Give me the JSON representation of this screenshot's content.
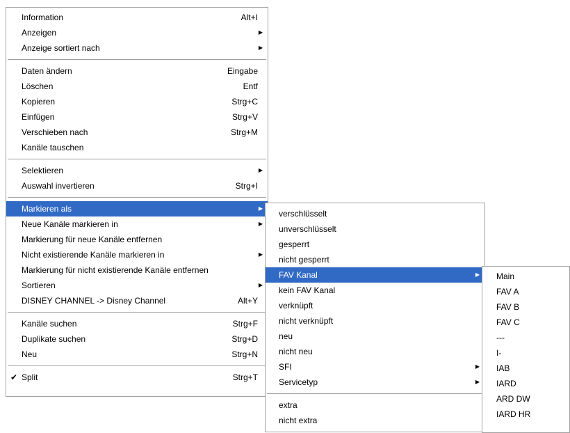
{
  "main_menu": {
    "groups": [
      [
        {
          "label": "Information",
          "shortcut": "Alt+I",
          "submenu": false
        },
        {
          "label": "Anzeigen",
          "shortcut": "",
          "submenu": true
        },
        {
          "label": "Anzeige sortiert nach",
          "shortcut": "",
          "submenu": true
        }
      ],
      [
        {
          "label": "Daten ändern",
          "shortcut": "Eingabe",
          "submenu": false
        },
        {
          "label": "Löschen",
          "shortcut": "Entf",
          "submenu": false
        },
        {
          "label": "Kopieren",
          "shortcut": "Strg+C",
          "submenu": false
        },
        {
          "label": "Einfügen",
          "shortcut": "Strg+V",
          "submenu": false
        },
        {
          "label": "Verschieben nach",
          "shortcut": "Strg+M",
          "submenu": false
        },
        {
          "label": "Kanäle tauschen",
          "shortcut": "",
          "submenu": false
        }
      ],
      [
        {
          "label": "Selektieren",
          "shortcut": "",
          "submenu": true
        },
        {
          "label": "Auswahl invertieren",
          "shortcut": "Strg+I",
          "submenu": false
        }
      ],
      [
        {
          "label": "Markieren als",
          "shortcut": "",
          "submenu": true,
          "highlighted": true
        },
        {
          "label": "Neue Kanäle markieren in",
          "shortcut": "",
          "submenu": true
        },
        {
          "label": "Markierung für neue Kanäle entfernen",
          "shortcut": "",
          "submenu": false
        },
        {
          "label": "Nicht existierende Kanäle markieren in",
          "shortcut": "",
          "submenu": true
        },
        {
          "label": "Markierung für nicht existierende Kanäle entfernen",
          "shortcut": "",
          "submenu": false
        },
        {
          "label": "Sortieren",
          "shortcut": "",
          "submenu": true
        },
        {
          "label": "DISNEY CHANNEL -> Disney Channel",
          "shortcut": "Alt+Y",
          "submenu": false
        }
      ],
      [
        {
          "label": "Kanäle suchen",
          "shortcut": "Strg+F",
          "submenu": false
        },
        {
          "label": "Duplikate suchen",
          "shortcut": "Strg+D",
          "submenu": false
        },
        {
          "label": "Neu",
          "shortcut": "Strg+N",
          "submenu": false
        }
      ],
      [
        {
          "label": "Split",
          "shortcut": "Strg+T",
          "submenu": false,
          "checked": true
        }
      ]
    ]
  },
  "submenu_markieren_als": {
    "groups": [
      [
        {
          "label": "verschlüsselt",
          "submenu": false
        },
        {
          "label": "unverschlüsselt",
          "submenu": false
        },
        {
          "label": "gesperrt",
          "submenu": false
        },
        {
          "label": "nicht gesperrt",
          "submenu": false
        },
        {
          "label": "FAV Kanal",
          "submenu": true,
          "highlighted": true
        },
        {
          "label": "kein FAV Kanal",
          "submenu": false
        },
        {
          "label": "verknüpft",
          "submenu": false
        },
        {
          "label": "nicht verknüpft",
          "submenu": false
        },
        {
          "label": "neu",
          "submenu": false
        },
        {
          "label": "nicht neu",
          "submenu": false
        },
        {
          "label": "SFI",
          "submenu": true
        },
        {
          "label": "Servicetyp",
          "submenu": true
        }
      ],
      [
        {
          "label": "extra",
          "submenu": false
        },
        {
          "label": "nicht extra",
          "submenu": false
        }
      ]
    ]
  },
  "submenu_fav_kanal": {
    "items": [
      {
        "label": "Main"
      },
      {
        "label": "FAV A"
      },
      {
        "label": "FAV B"
      },
      {
        "label": "FAV C"
      },
      {
        "label": "---"
      },
      {
        "label": "I-"
      },
      {
        "label": "IAB"
      },
      {
        "label": "IARD"
      },
      {
        "label": "ARD DW"
      },
      {
        "label": "IARD HR"
      }
    ]
  },
  "colors": {
    "highlight": "#316ac5",
    "highlight_text": "#ffffff",
    "border": "#a0a0a0"
  },
  "icons": {
    "submenu_arrow": "chevron-right-icon",
    "check": "check-icon"
  }
}
